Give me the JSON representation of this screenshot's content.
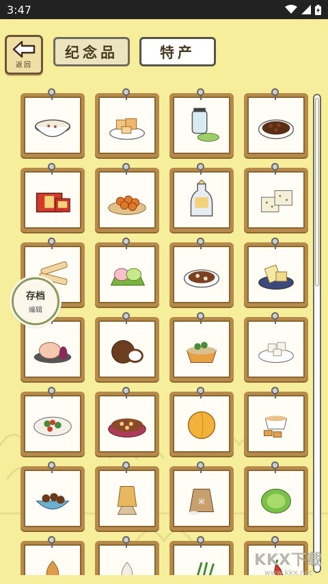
{
  "status_bar": {
    "time": "3:47",
    "icons": [
      "wifi-icon",
      "signal-icon",
      "battery-icon"
    ]
  },
  "header": {
    "back_label": "返回",
    "tabs": [
      {
        "label": "纪念品",
        "active": true
      },
      {
        "label": "特产",
        "active": false
      }
    ]
  },
  "grid": {
    "items": [
      {
        "name": "porridge-bowl"
      },
      {
        "name": "fried-tofu"
      },
      {
        "name": "jar-and-cake"
      },
      {
        "name": "beans-plate"
      },
      {
        "name": "gift-box"
      },
      {
        "name": "fried-balls"
      },
      {
        "name": "wine-bottle"
      },
      {
        "name": "rice-cakes"
      },
      {
        "name": "fried-dough"
      },
      {
        "name": "rice-dumplings"
      },
      {
        "name": "braised-meat"
      },
      {
        "name": "tofu-blocks"
      },
      {
        "name": "mooncake"
      },
      {
        "name": "coconut"
      },
      {
        "name": "noodle-bowl"
      },
      {
        "name": "tofu-plate"
      },
      {
        "name": "salad-plate"
      },
      {
        "name": "dim-sum-platter"
      },
      {
        "name": "apricot"
      },
      {
        "name": "tea-and-snacks"
      },
      {
        "name": "braised-dish"
      },
      {
        "name": "corn-cob"
      },
      {
        "name": "rice-sack"
      },
      {
        "name": "cabbage"
      },
      {
        "name": "onion"
      },
      {
        "name": "garlic"
      },
      {
        "name": "scallion"
      },
      {
        "name": "pepper"
      }
    ]
  },
  "save_button": {
    "title": "存档",
    "subtitle": "编辑"
  },
  "watermark": {
    "brand": "KKX下载",
    "url": "www.kkx.net"
  },
  "colors": {
    "background": "#f7ee9c",
    "card_frame": "#b58a4a",
    "card_inner": "#fffdf6"
  }
}
